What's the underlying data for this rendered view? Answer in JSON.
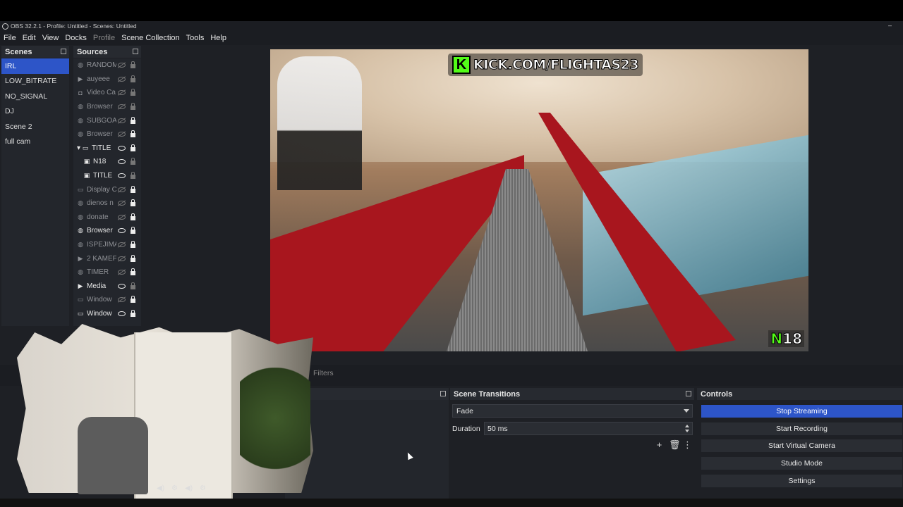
{
  "window": {
    "title": "OBS 32.2.1 - Profile: Untitled - Scenes: Untitled",
    "minimize": "–"
  },
  "menu": {
    "items": [
      "File",
      "Edit",
      "View",
      "Docks",
      "Profile",
      "Scene Collection",
      "Tools",
      "Help"
    ]
  },
  "scenes": {
    "header": "Scenes",
    "items": [
      "IRL",
      "LOW_BITRATE",
      "NO_SIGNAL",
      "DJ",
      "Scene 2",
      "full cam"
    ],
    "selected": "IRL"
  },
  "sources": {
    "header": "Sources",
    "items": [
      {
        "name": "RANDOM",
        "icon": "globe-icon",
        "visible": false,
        "locked": false
      },
      {
        "name": "auyeee",
        "icon": "play-icon",
        "visible": false,
        "locked": false
      },
      {
        "name": "Video Ca",
        "icon": "camera-icon",
        "visible": false,
        "locked": false
      },
      {
        "name": "Browser",
        "icon": "globe-icon",
        "visible": false,
        "locked": false
      },
      {
        "name": "SUBGOA",
        "icon": "globe-icon",
        "visible": false,
        "locked": true
      },
      {
        "name": "Browser",
        "icon": "globe-icon",
        "visible": false,
        "locked": true
      },
      {
        "name": "TITLE",
        "icon": "folder-icon",
        "visible": true,
        "locked": true
      },
      {
        "name": "N18",
        "icon": "image-icon",
        "visible": true,
        "locked": false
      },
      {
        "name": "TITLE",
        "icon": "image-icon",
        "visible": true,
        "locked": false
      },
      {
        "name": "Display C",
        "icon": "monitor-icon",
        "visible": false,
        "locked": true
      },
      {
        "name": "dienos n",
        "icon": "globe-icon",
        "visible": false,
        "locked": true
      },
      {
        "name": "donate",
        "icon": "globe-icon",
        "visible": false,
        "locked": true
      },
      {
        "name": "Browser",
        "icon": "globe-icon",
        "visible": true,
        "locked": true
      },
      {
        "name": "ISPEJIMA",
        "icon": "globe-icon",
        "visible": false,
        "locked": true
      },
      {
        "name": "2 KAMEF",
        "icon": "play-icon",
        "visible": false,
        "locked": true
      },
      {
        "name": "TIMER",
        "icon": "globe-icon",
        "visible": false,
        "locked": true
      },
      {
        "name": "Media",
        "icon": "play-icon",
        "visible": true,
        "locked": false
      },
      {
        "name": "Window",
        "icon": "window-icon",
        "visible": false,
        "locked": true
      },
      {
        "name": "Window",
        "icon": "window-icon",
        "visible": true,
        "locked": true
      }
    ]
  },
  "preview": {
    "overlay_title": "KICK.COM/FLIGHTAS23",
    "overlay_logo": "K",
    "overlay_badge_letter": "N",
    "overlay_badge_number": "18"
  },
  "bottom": {
    "filters_label": "Filters"
  },
  "transitions": {
    "header": "Scene Transitions",
    "selected": "Fade",
    "duration_label": "Duration",
    "duration_value": "50 ms",
    "add": "+",
    "remove": "🗑",
    "more": "⋮"
  },
  "controls": {
    "header": "Controls",
    "buttons": [
      "Stop Streaming",
      "Start Recording",
      "Start Virtual Camera",
      "Studio Mode",
      "Settings"
    ],
    "active": "Stop Streaming"
  },
  "colors": {
    "accent": "#2d55c8",
    "kick_green": "#53fc18",
    "panel": "#23262c",
    "background": "#1e2025"
  }
}
